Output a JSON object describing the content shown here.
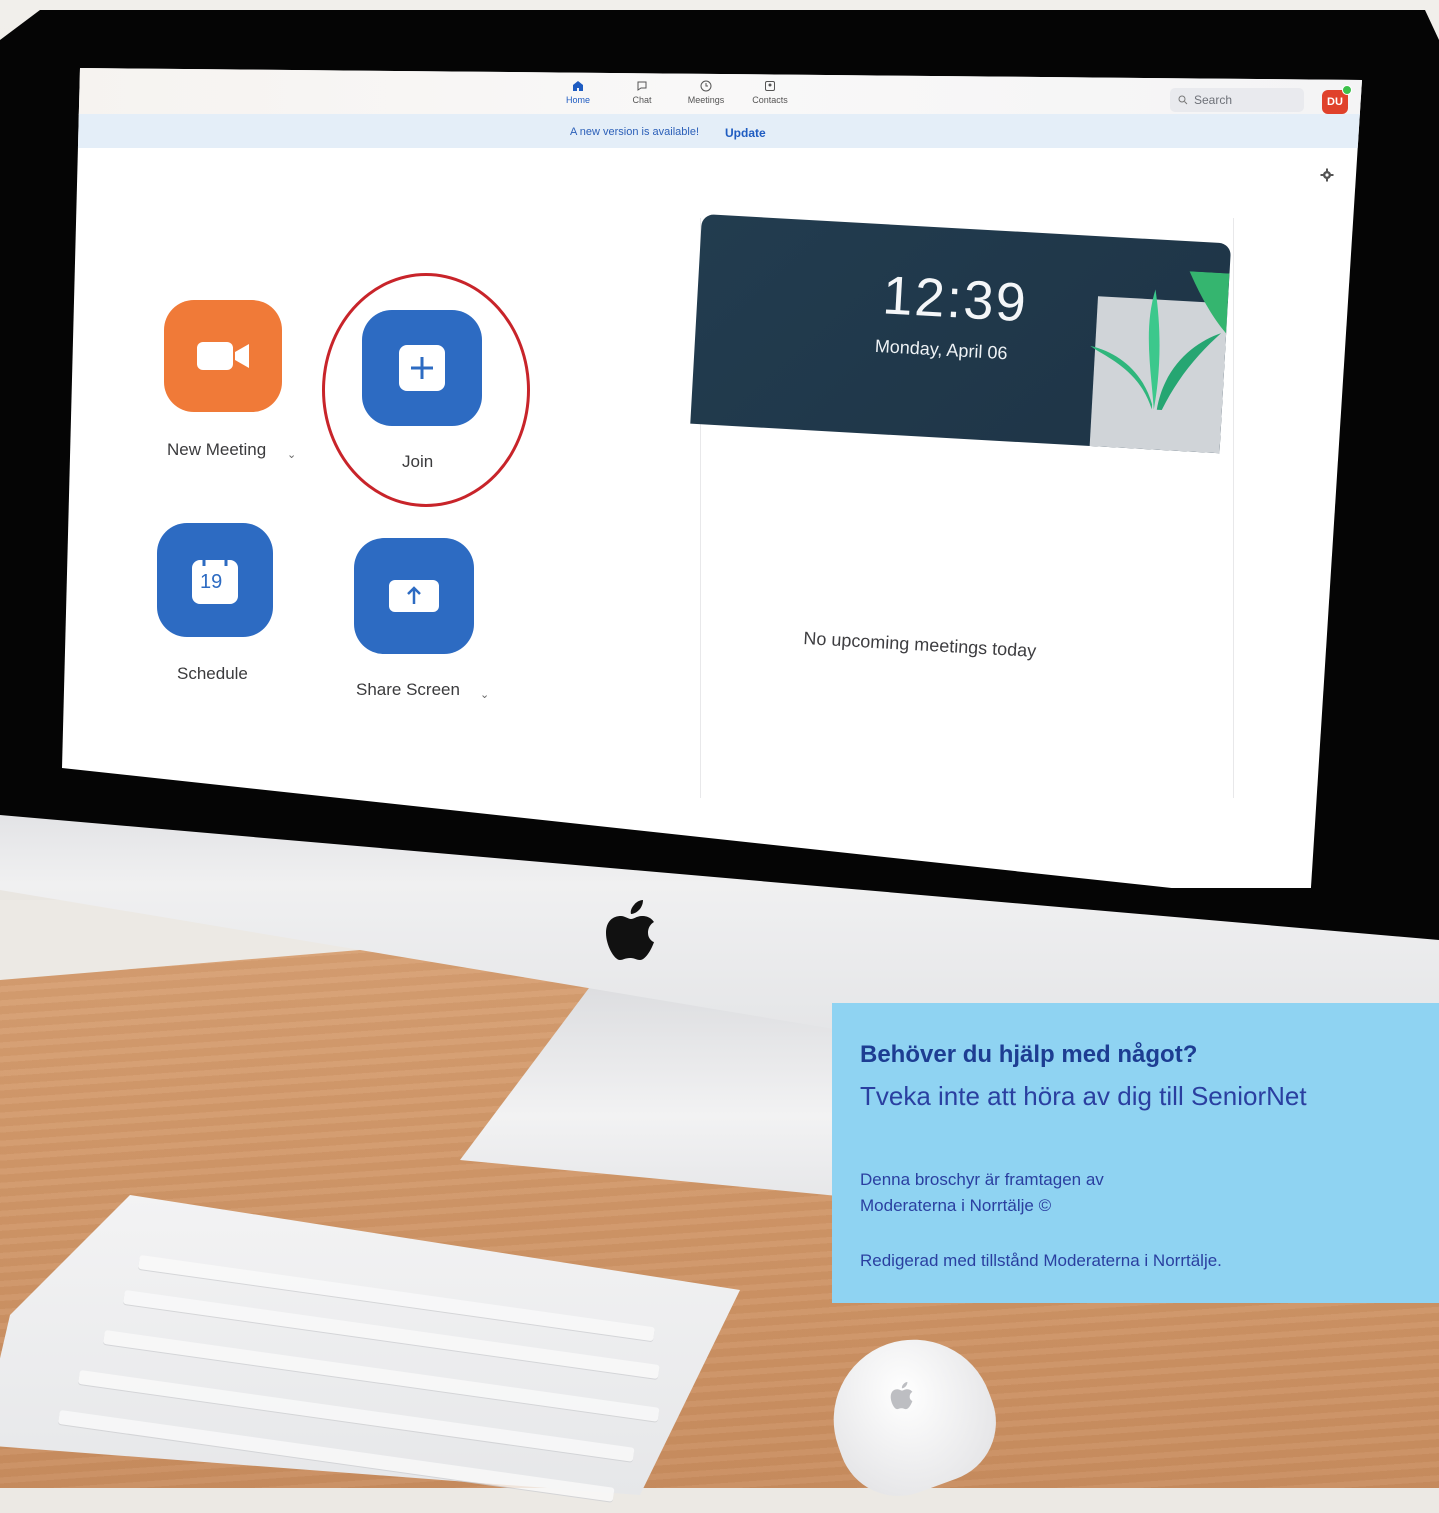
{
  "app": {
    "nav": [
      {
        "label": "Home",
        "icon": "home-icon",
        "active": true
      },
      {
        "label": "Chat",
        "icon": "chat-icon",
        "active": false
      },
      {
        "label": "Meetings",
        "icon": "clock-icon",
        "active": false
      },
      {
        "label": "Contacts",
        "icon": "contacts-icon",
        "active": false
      }
    ],
    "search_placeholder": "Search",
    "avatar_initials": "DU",
    "update_message": "A new version is available!",
    "update_link": "Update",
    "actions": {
      "new_meeting": "New Meeting",
      "join": "Join",
      "schedule": "Schedule",
      "share_screen": "Share Screen",
      "calendar_day": "19"
    },
    "time": "12:39",
    "date": "Monday, April 06",
    "no_meetings": "No upcoming meetings today",
    "colors": {
      "accent": "#2d6bc2",
      "orange": "#f07a38",
      "highlight_ring": "#c8242a",
      "avatar": "#e0412b"
    }
  },
  "panel": {
    "heading": "Behöver du hjälp med något?",
    "subheading": "Tveka inte att höra av dig till SeniorNet",
    "credit_line1": "Denna broschyr är framtagen av",
    "credit_line2": "Moderaterna i Norrtälje ©",
    "edited": "Redigerad med tillstånd Moderaterna i Norrtälje.",
    "background": "#8fd3f2"
  }
}
